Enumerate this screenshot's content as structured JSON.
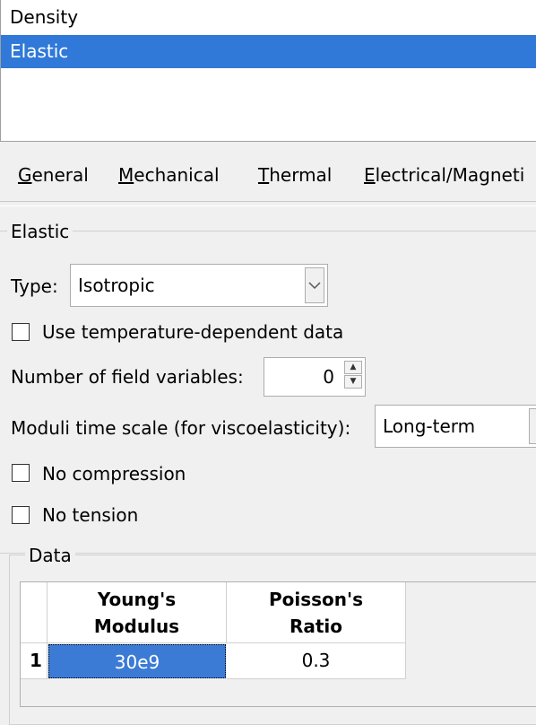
{
  "behaviors": {
    "items": [
      {
        "label": "Density",
        "selected": false
      },
      {
        "label": "Elastic",
        "selected": true
      }
    ]
  },
  "menubar": {
    "general": {
      "mnemonic": "G",
      "rest": "eneral"
    },
    "mechanical": {
      "mnemonic": "M",
      "rest": "echanical"
    },
    "thermal": {
      "mnemonic": "T",
      "rest": "hermal"
    },
    "electrical": {
      "mnemonic": "E",
      "rest": "lectrical/Magneti"
    }
  },
  "elastic": {
    "group_title": "Elastic",
    "type_label": "Type:",
    "type_value": "Isotropic",
    "temp_dependent_label": "Use temperature-dependent data",
    "temp_dependent_checked": false,
    "field_vars_label": "Number of field variables:",
    "field_vars_value": "0",
    "moduli_label": "Moduli time scale (for viscoelasticity):",
    "moduli_value": "Long-term",
    "no_compression_label": "No compression",
    "no_compression_checked": false,
    "no_tension_label": "No tension",
    "no_tension_checked": false
  },
  "data": {
    "group_title": "Data",
    "columns": [
      {
        "line1": "Young's",
        "line2": "Modulus"
      },
      {
        "line1": "Poisson's",
        "line2": "Ratio"
      }
    ],
    "rows": [
      {
        "index": "1",
        "values": [
          "30e9",
          "0.3"
        ]
      }
    ]
  },
  "colors": {
    "selection": "#3079d8",
    "background": "#f0f0f0"
  }
}
